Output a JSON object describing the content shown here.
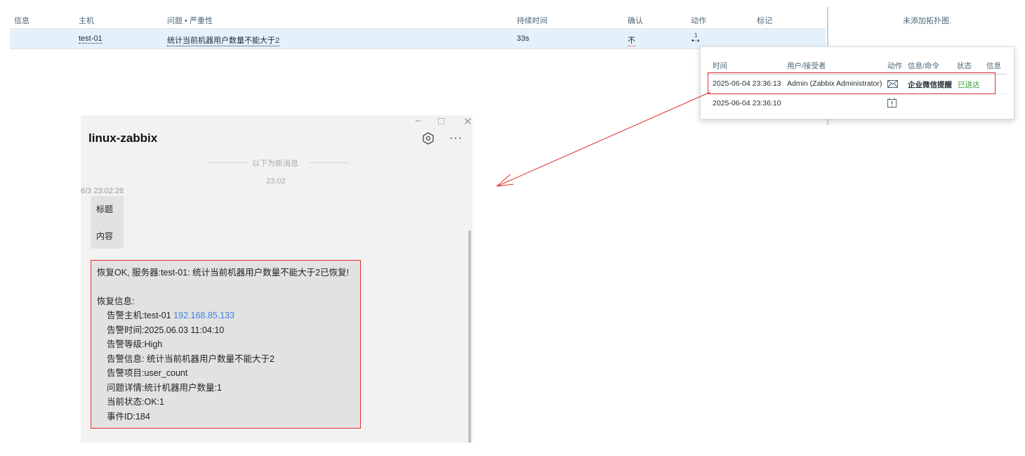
{
  "problems_table": {
    "headers": {
      "info": "信息",
      "host": "主机",
      "problem_severity": "问题 • 严重性",
      "duration": "持续时间",
      "ack": "确认",
      "actions": "动作",
      "tags": "标记"
    },
    "row": {
      "host": "test-01",
      "problem": "统计当前机器用户数量不能大于2",
      "duration": "33s",
      "ack": "不",
      "actions_count": "1"
    },
    "no_map_text": "未添加拓扑图."
  },
  "actions_popup": {
    "headers": {
      "time": "时间",
      "user_recipient": "用户/接受者",
      "action": "动作",
      "message_command": "信息/命令",
      "status": "状态",
      "info": "信息"
    },
    "rows": [
      {
        "time": "2025-06-04 23:36:13",
        "user": "Admin (Zabbix Administrator)",
        "action_icon": "mail-icon",
        "message": "企业微信提醒",
        "status": "已送达"
      },
      {
        "time": "2025-06-04 23:36:10",
        "action_icon": "calendar-alert-icon"
      }
    ]
  },
  "chat_window": {
    "title": "linux-zabbix",
    "controls": {
      "minimize": "−",
      "maximize": "□",
      "close": "✕"
    },
    "more": "···",
    "new_messages_divider": "以下为新消息",
    "center_time": "23:02",
    "message_time": "6/3 23:02:28",
    "bubble1": {
      "title": "标题",
      "content": "内容"
    },
    "bubble2": {
      "line1": "恢复OK, 服务器:test-01: 统计当前机器用户数量不能大于2已恢复!",
      "recovery_info": "恢复信息:",
      "host_prefix": "告警主机:test-01 ",
      "host_ip": "192.168.85.133",
      "alert_time": "告警时间:2025.06.03 11:04:10",
      "alert_level": "告警等级:High",
      "alert_info": "告警信息: 统计当前机器用户数量不能大于2",
      "alert_item": "告警项目:user_count",
      "problem_detail": "问题详情:统计机器用户数量:1",
      "current_status": "当前状态:OK:1",
      "event_id": "事件ID:184"
    }
  },
  "colors": {
    "highlight_red": "#e03030",
    "sent_green": "#2e9d2e",
    "ip_blue": "#3f7fe0",
    "row_highlight": "#e4f1fb"
  }
}
